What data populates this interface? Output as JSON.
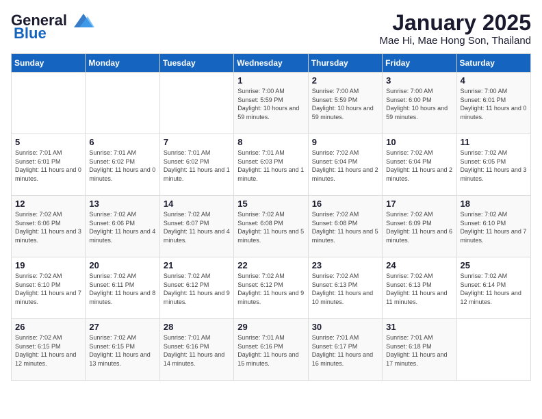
{
  "logo": {
    "line1": "General",
    "line2": "Blue"
  },
  "header": {
    "month": "January 2025",
    "location": "Mae Hi, Mae Hong Son, Thailand"
  },
  "days_of_week": [
    "Sunday",
    "Monday",
    "Tuesday",
    "Wednesday",
    "Thursday",
    "Friday",
    "Saturday"
  ],
  "weeks": [
    [
      {
        "day": "",
        "info": ""
      },
      {
        "day": "",
        "info": ""
      },
      {
        "day": "",
        "info": ""
      },
      {
        "day": "1",
        "info": "Sunrise: 7:00 AM\nSunset: 5:59 PM\nDaylight: 10 hours\nand 59 minutes."
      },
      {
        "day": "2",
        "info": "Sunrise: 7:00 AM\nSunset: 5:59 PM\nDaylight: 10 hours\nand 59 minutes."
      },
      {
        "day": "3",
        "info": "Sunrise: 7:00 AM\nSunset: 6:00 PM\nDaylight: 10 hours\nand 59 minutes."
      },
      {
        "day": "4",
        "info": "Sunrise: 7:00 AM\nSunset: 6:01 PM\nDaylight: 11 hours\nand 0 minutes."
      }
    ],
    [
      {
        "day": "5",
        "info": "Sunrise: 7:01 AM\nSunset: 6:01 PM\nDaylight: 11 hours\nand 0 minutes."
      },
      {
        "day": "6",
        "info": "Sunrise: 7:01 AM\nSunset: 6:02 PM\nDaylight: 11 hours\nand 0 minutes."
      },
      {
        "day": "7",
        "info": "Sunrise: 7:01 AM\nSunset: 6:02 PM\nDaylight: 11 hours\nand 1 minute."
      },
      {
        "day": "8",
        "info": "Sunrise: 7:01 AM\nSunset: 6:03 PM\nDaylight: 11 hours\nand 1 minute."
      },
      {
        "day": "9",
        "info": "Sunrise: 7:02 AM\nSunset: 6:04 PM\nDaylight: 11 hours\nand 2 minutes."
      },
      {
        "day": "10",
        "info": "Sunrise: 7:02 AM\nSunset: 6:04 PM\nDaylight: 11 hours\nand 2 minutes."
      },
      {
        "day": "11",
        "info": "Sunrise: 7:02 AM\nSunset: 6:05 PM\nDaylight: 11 hours\nand 3 minutes."
      }
    ],
    [
      {
        "day": "12",
        "info": "Sunrise: 7:02 AM\nSunset: 6:06 PM\nDaylight: 11 hours\nand 3 minutes."
      },
      {
        "day": "13",
        "info": "Sunrise: 7:02 AM\nSunset: 6:06 PM\nDaylight: 11 hours\nand 4 minutes."
      },
      {
        "day": "14",
        "info": "Sunrise: 7:02 AM\nSunset: 6:07 PM\nDaylight: 11 hours\nand 4 minutes."
      },
      {
        "day": "15",
        "info": "Sunrise: 7:02 AM\nSunset: 6:08 PM\nDaylight: 11 hours\nand 5 minutes."
      },
      {
        "day": "16",
        "info": "Sunrise: 7:02 AM\nSunset: 6:08 PM\nDaylight: 11 hours\nand 5 minutes."
      },
      {
        "day": "17",
        "info": "Sunrise: 7:02 AM\nSunset: 6:09 PM\nDaylight: 11 hours\nand 6 minutes."
      },
      {
        "day": "18",
        "info": "Sunrise: 7:02 AM\nSunset: 6:10 PM\nDaylight: 11 hours\nand 7 minutes."
      }
    ],
    [
      {
        "day": "19",
        "info": "Sunrise: 7:02 AM\nSunset: 6:10 PM\nDaylight: 11 hours\nand 7 minutes."
      },
      {
        "day": "20",
        "info": "Sunrise: 7:02 AM\nSunset: 6:11 PM\nDaylight: 11 hours\nand 8 minutes."
      },
      {
        "day": "21",
        "info": "Sunrise: 7:02 AM\nSunset: 6:12 PM\nDaylight: 11 hours\nand 9 minutes."
      },
      {
        "day": "22",
        "info": "Sunrise: 7:02 AM\nSunset: 6:12 PM\nDaylight: 11 hours\nand 9 minutes."
      },
      {
        "day": "23",
        "info": "Sunrise: 7:02 AM\nSunset: 6:13 PM\nDaylight: 11 hours\nand 10 minutes."
      },
      {
        "day": "24",
        "info": "Sunrise: 7:02 AM\nSunset: 6:13 PM\nDaylight: 11 hours\nand 11 minutes."
      },
      {
        "day": "25",
        "info": "Sunrise: 7:02 AM\nSunset: 6:14 PM\nDaylight: 11 hours\nand 12 minutes."
      }
    ],
    [
      {
        "day": "26",
        "info": "Sunrise: 7:02 AM\nSunset: 6:15 PM\nDaylight: 11 hours\nand 12 minutes."
      },
      {
        "day": "27",
        "info": "Sunrise: 7:02 AM\nSunset: 6:15 PM\nDaylight: 11 hours\nand 13 minutes."
      },
      {
        "day": "28",
        "info": "Sunrise: 7:01 AM\nSunset: 6:16 PM\nDaylight: 11 hours\nand 14 minutes."
      },
      {
        "day": "29",
        "info": "Sunrise: 7:01 AM\nSunset: 6:16 PM\nDaylight: 11 hours\nand 15 minutes."
      },
      {
        "day": "30",
        "info": "Sunrise: 7:01 AM\nSunset: 6:17 PM\nDaylight: 11 hours\nand 16 minutes."
      },
      {
        "day": "31",
        "info": "Sunrise: 7:01 AM\nSunset: 6:18 PM\nDaylight: 11 hours\nand 17 minutes."
      },
      {
        "day": "",
        "info": ""
      }
    ]
  ]
}
